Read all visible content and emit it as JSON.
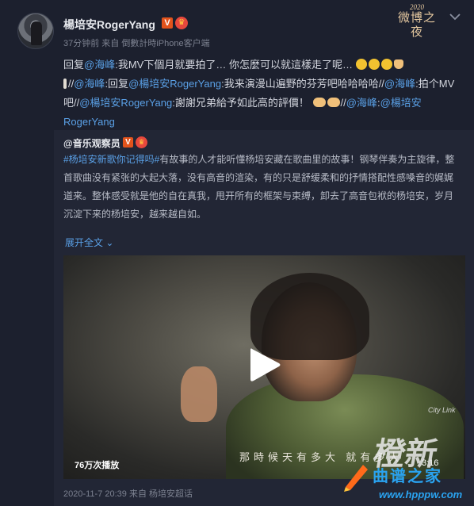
{
  "post": {
    "username": "楊培安RogerYang",
    "v_badge": "V",
    "meta": "37分钟前 来自 倒數計時iPhone客户端",
    "event_logo_year": "2020",
    "event_logo_name": "微博之夜",
    "text": {
      "p1_prefix": "回复",
      "p1_link": "@海峰",
      "p1_body": ":我MV下個月就要拍了… 你怎麼可以就這樣走了呢…",
      "p2_sep": "//",
      "p2_link": "@海峰",
      "p2_mid": ":回复",
      "p2_link2": "@楊培安RogerYang",
      "p2_body": ":我来演漫山遍野的芬芳吧哈哈哈哈//",
      "p2_link3": "@海峰",
      "p2_body2": ":拍个MV吧//",
      "p2_link4": "@楊培安RogerYang",
      "p2_body3": ":謝謝兄弟給予如此高的評價！",
      "p2_sep2": "//",
      "p2_link5": "@海峰",
      "p2_colon": ":",
      "p2_link6": "@楊培安RogerYang"
    }
  },
  "repost": {
    "author": "@音乐观察员",
    "hashtag": "#杨培安新歌你记得吗#",
    "body": "有故事的人才能听懂杨培安藏在歌曲里的故事！钢琴伴奏为主旋律，整首歌曲没有紧张的大起大落，没有高音的渲染，有的只是舒缓柔和的抒情搭配性感嗓音的娓娓道来。整体感受就是他的自在真我，甩开所有的框架与束缚，卸去了高音包袱的杨培安，岁月沉淀下来的杨培安，越来越自如。",
    "expand": "展开全文",
    "video": {
      "views": "76万次播放",
      "duration": "3:16",
      "subtitle": "那時候天有多大 就有多大",
      "channel": "City Link"
    },
    "footer": "2020-11-7 20:39 来自 杨培安超话"
  },
  "watermark": {
    "big": "橙新",
    "cn": "曲谱之家",
    "url": "www.hpppw.com"
  },
  "colors": {
    "background": "#1c202e",
    "link": "#5aa0e6",
    "repost_bg": "#222635"
  },
  "icons": [
    "chevron-down-icon",
    "play-icon",
    "v-verified-icon",
    "crown-icon"
  ]
}
